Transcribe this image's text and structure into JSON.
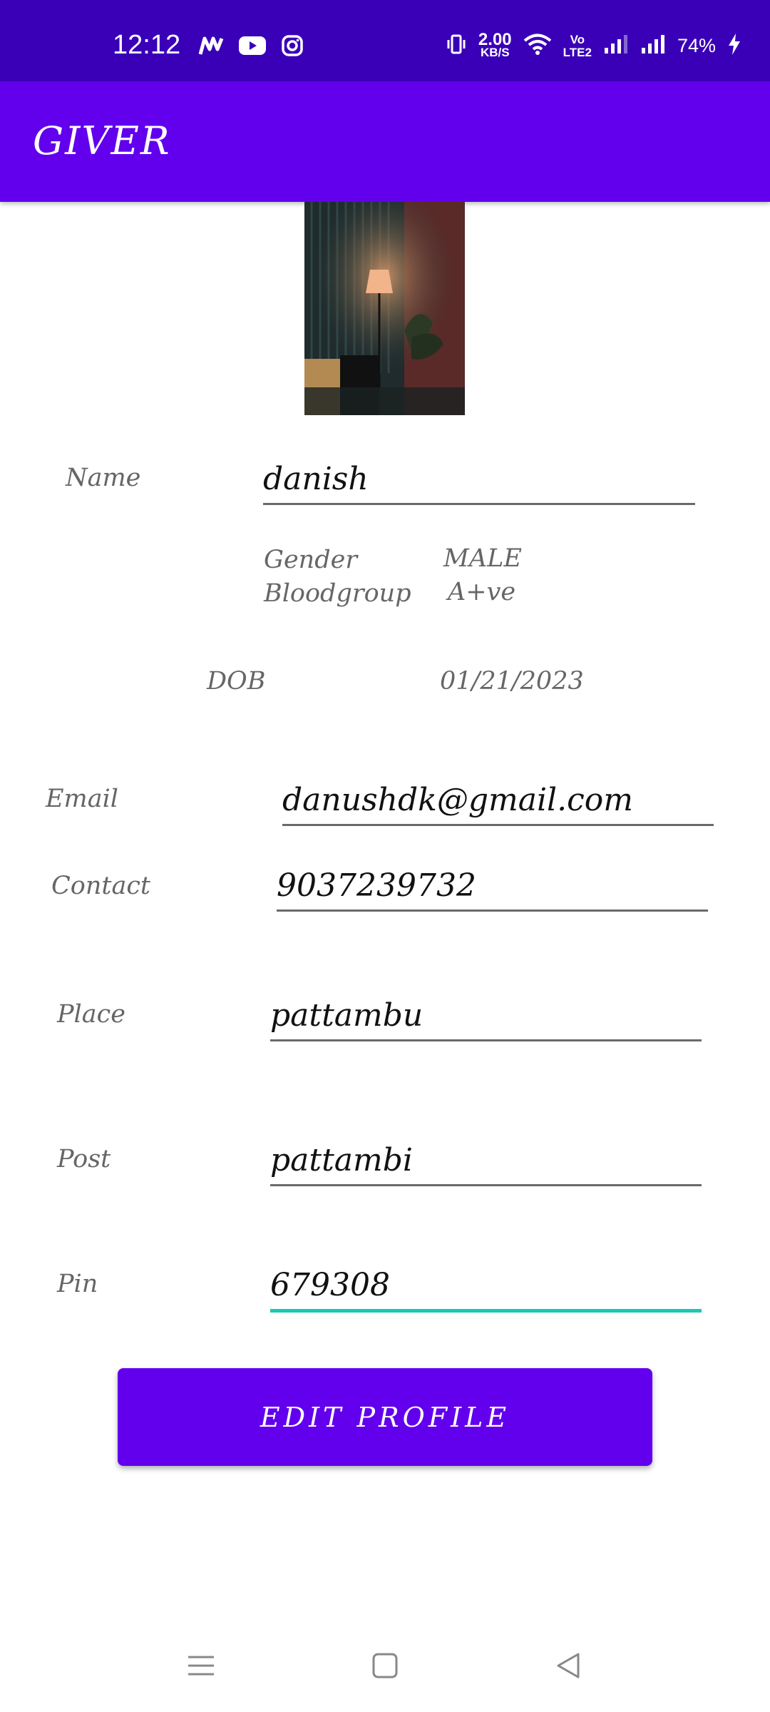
{
  "status_bar": {
    "time": "12:12",
    "left_icons": [
      "myntra-icon",
      "youtube-icon",
      "instagram-icon"
    ],
    "speed_value": "2.00",
    "speed_unit": "KB/S",
    "volte_label_top": "Vo",
    "volte_label_bottom": "LTE2",
    "battery": "74%"
  },
  "app_bar": {
    "title": "GIVER"
  },
  "profile": {
    "name_label": "Name",
    "name_value": "danish",
    "gender_label": "Gender",
    "gender_value": "MALE",
    "bloodgroup_label": "Bloodgroup",
    "bloodgroup_value": "A+ve",
    "dob_label": "DOB",
    "dob_value": "01/21/2023",
    "email_label": "Email",
    "email_value": "danushdk@gmail.com",
    "contact_label": "Contact",
    "contact_value": "9037239732",
    "place_label": "Place",
    "place_value": "pattambu",
    "post_label": "Post",
    "post_value": "pattambi",
    "pin_label": "Pin",
    "pin_value": "679308"
  },
  "actions": {
    "edit_profile": "EDIT PROFILE"
  },
  "colors": {
    "status_bar": "#3a00b8",
    "primary": "#6200ee",
    "focus_underline": "#1ac9b3"
  }
}
